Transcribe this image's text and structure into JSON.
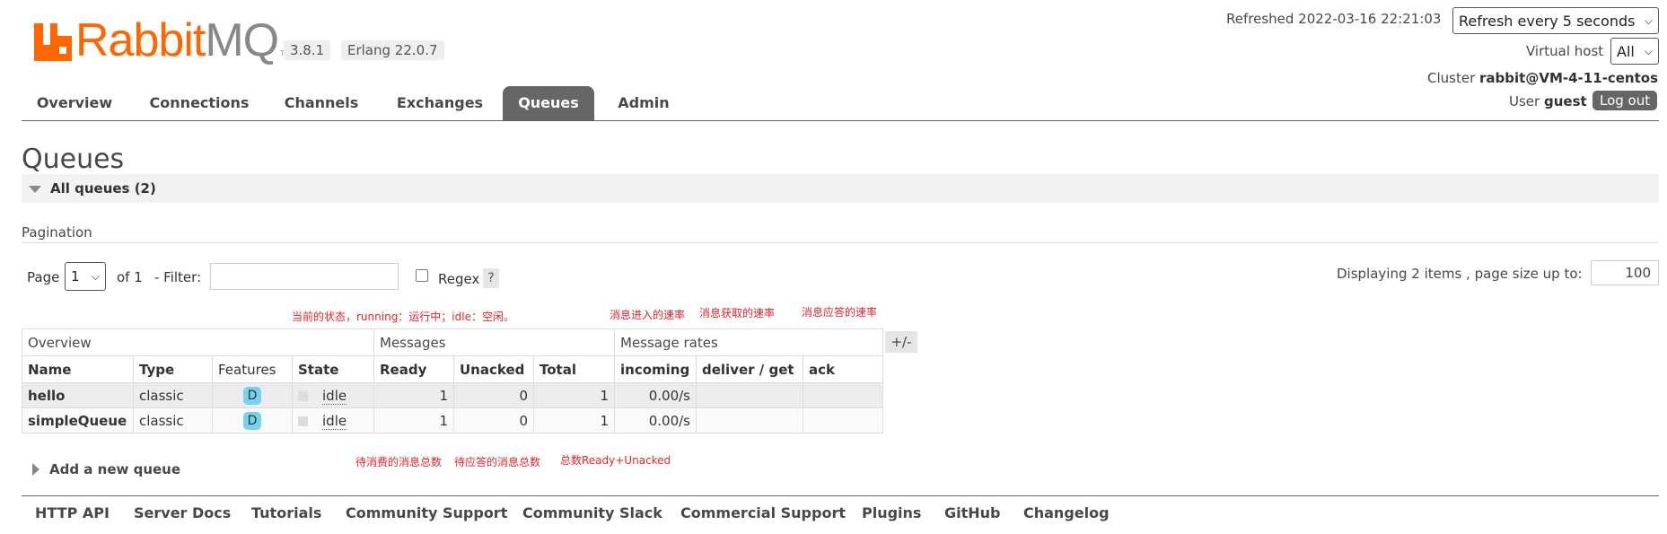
{
  "header": {
    "logo_text_rabbit": "Rabbit",
    "logo_text_mq": "MQ",
    "logo_tm": "TM",
    "version": "3.8.1",
    "erlang": "Erlang 22.0.7",
    "refreshed_label": "Refreshed 2022-03-16 22:21:03",
    "refresh_select": "Refresh every 5 seconds",
    "vhost_label": "Virtual host",
    "vhost_select": "All",
    "cluster_label": "Cluster",
    "cluster_name": "rabbit@VM-4-11-centos",
    "user_label": "User",
    "user_name": "guest",
    "logout_label": "Log out"
  },
  "nav": {
    "tabs": [
      "Overview",
      "Connections",
      "Channels",
      "Exchanges",
      "Queues",
      "Admin"
    ],
    "active": "Queues"
  },
  "page": {
    "title": "Queues",
    "section_title": "All queues (2)",
    "pagination_label": "Pagination",
    "page_label": "Page",
    "page_value": "1",
    "of_label": "of 1",
    "filter_label": "- Filter:",
    "regex_label": "Regex",
    "regex_help": "?",
    "displaying_label": "Displaying 2 items , page size up to:",
    "page_size": "100",
    "add_queue_label": "Add a new queue"
  },
  "annotations": {
    "state": "当前的状态，running：运行中；idle：空闲。",
    "incoming": "消息进入的速率",
    "deliver": "消息获取的速率",
    "ack": "消息应答的速率",
    "ready": "待消费的消息总数",
    "unacked": "待应答的消息总数",
    "total": "总数Ready+Unacked"
  },
  "table": {
    "groups": [
      "Overview",
      "Messages",
      "Message rates"
    ],
    "plusminus": "+/-",
    "columns": [
      "Name",
      "Type",
      "Features",
      "State",
      "Ready",
      "Unacked",
      "Total",
      "incoming",
      "deliver / get",
      "ack"
    ],
    "rows": [
      {
        "name": "hello",
        "type": "classic",
        "feature": "D",
        "state": "idle",
        "ready": "1",
        "unacked": "0",
        "total": "1",
        "incoming": "0.00/s",
        "deliver": "",
        "ack": ""
      },
      {
        "name": "simpleQueue",
        "type": "classic",
        "feature": "D",
        "state": "idle",
        "ready": "1",
        "unacked": "0",
        "total": "1",
        "incoming": "0.00/s",
        "deliver": "",
        "ack": ""
      }
    ]
  },
  "footer": {
    "links": [
      "HTTP API",
      "Server Docs",
      "Tutorials",
      "Community Support",
      "Community Slack",
      "Commercial Support",
      "Plugins",
      "GitHub",
      "Changelog"
    ]
  },
  "colors": {
    "brand_orange": "#ff6600",
    "nav_active_bg": "#666666",
    "annotation_red": "#e8222d",
    "durable_badge": "#75d2f0"
  }
}
